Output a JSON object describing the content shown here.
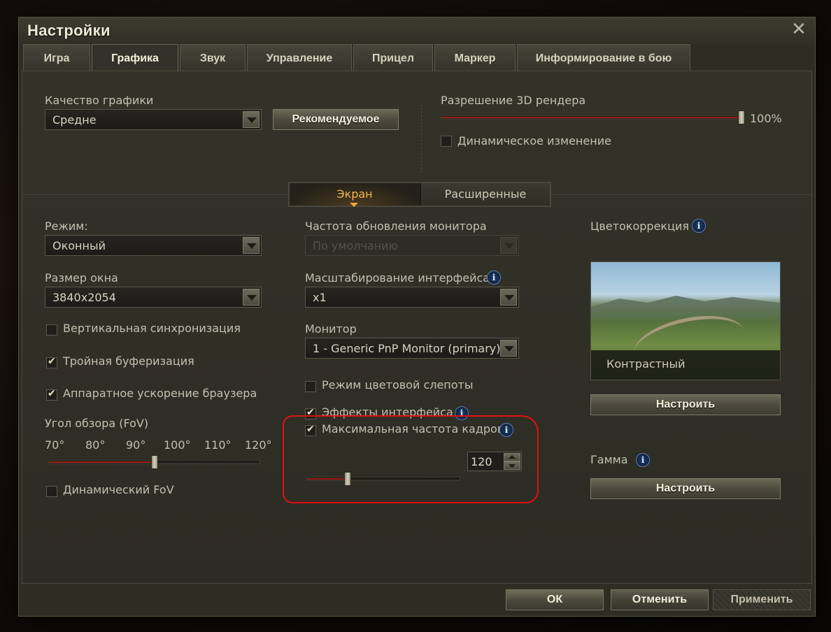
{
  "window": {
    "title": "Настройки",
    "close_icon": "close-icon"
  },
  "tabs": [
    {
      "label": "Игра",
      "active": false
    },
    {
      "label": "Графика",
      "active": true
    },
    {
      "label": "Звук",
      "active": false
    },
    {
      "label": "Управление",
      "active": false
    },
    {
      "label": "Прицел",
      "active": false
    },
    {
      "label": "Маркер",
      "active": false
    },
    {
      "label": "Информирование в бою",
      "active": false
    }
  ],
  "quality": {
    "label": "Качество графики",
    "value": "Средне",
    "recommended_button": "Рекомендуемое"
  },
  "render": {
    "label": "Разрешение 3D рендера",
    "value_text": "100%",
    "level": 1.0,
    "dynamic_label": "Динамическое изменение",
    "dynamic_checked": false
  },
  "subtabs": {
    "screen": "Экран",
    "advanced": "Расширенные"
  },
  "left": {
    "mode_label": "Режим:",
    "mode_value": "Оконный",
    "size_label": "Размер окна",
    "size_value": "3840x2054",
    "vsync_label": "Вертикальная синхронизация",
    "vsync_checked": false,
    "triple_label": "Тройная буферизация",
    "triple_checked": true,
    "browser_label": "Аппаратное ускорение браузера",
    "browser_checked": true,
    "fov_label": "Угол обзора (FoV)",
    "fov_ticks": [
      "70°",
      "80°",
      "90°",
      "100°",
      "110°",
      "120°"
    ],
    "fov_value": 95,
    "fov_range": [
      70,
      120
    ],
    "dyn_fov_label": "Динамический FoV",
    "dyn_fov_checked": false
  },
  "middle": {
    "refresh_label": "Частота обновления монитора",
    "refresh_value": "По умолчанию",
    "scale_label": "Масштабирование интерфейса",
    "scale_value": "x1",
    "monitor_label": "Монитор",
    "monitor_value": "1 - Generic PnP Monitor (primary)",
    "colorblind_label": "Режим цветовой слепоты",
    "colorblind_checked": false,
    "effects_label": "Эффекты интерфейса",
    "effects_checked": true,
    "maxfps_label": "Максимальная частота кадров",
    "maxfps_checked": true,
    "fps_value": "120",
    "fps_level": 0.27
  },
  "right": {
    "color_label": "Цветокоррекция",
    "color_preset": "Контрастный",
    "configure_button": "Настроить",
    "gamma_label": "Гамма",
    "gamma_button": "Настроить"
  },
  "footer": {
    "ok": "ОК",
    "cancel": "Отменить",
    "apply": "Применить"
  },
  "info_glyph": "i",
  "colors": {
    "accent_tab": "#f2b54b",
    "slider_fill": "#9d1f16",
    "annotation": "#e01010"
  }
}
